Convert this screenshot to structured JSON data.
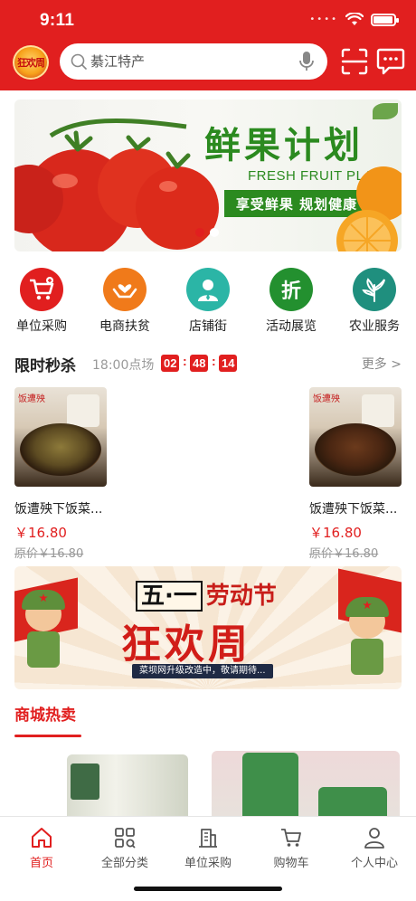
{
  "status_bar": {
    "time": "9:11",
    "battery_level": 0.95
  },
  "header": {
    "logo_text": "狂欢周",
    "search_placeholder": "綦江特产",
    "icons": [
      "search-icon",
      "microphone-icon",
      "scan-icon",
      "message-icon"
    ]
  },
  "banner": {
    "title": "鲜果计划",
    "subtitle": "FRESH FRUIT PLAN",
    "slogan": "享受鲜果  规划健康",
    "page_count": 2,
    "active_page": 1
  },
  "categories": [
    {
      "label": "单位采购",
      "icon": "cart-icon",
      "color": "#e11f1f"
    },
    {
      "label": "电商扶贫",
      "icon": "hands-heart-icon",
      "color": "#f07a1a"
    },
    {
      "label": "店铺街",
      "icon": "person-icon",
      "color": "#2bb5a6"
    },
    {
      "label": "活动展览",
      "icon": "discount-icon",
      "color": "#23902f"
    },
    {
      "label": "农业服务",
      "icon": "plant-icon",
      "color": "#1f8f7e"
    }
  ],
  "flash_sale": {
    "title": "限时秒杀",
    "session": "18:00点场",
    "countdown": [
      "02",
      "48",
      "14"
    ],
    "more": "更多 >",
    "products": [
      {
        "brand": "饭遭殃",
        "name": "饭遭殃下饭菜...",
        "price": "￥16.80",
        "original_price": "原价￥16.80"
      },
      {
        "brand": "饭遭殃",
        "name": "饭遭殃下饭菜...",
        "price": "￥16.80",
        "original_price": "原价￥16.80"
      }
    ]
  },
  "promo": {
    "title_box": "五·一",
    "title_rest": "劳动节",
    "headline": "狂欢周",
    "note": "菜坝网升级改造中，敬请期待..."
  },
  "hot_section": {
    "title": "商城热卖"
  },
  "tabbar": {
    "tabs": [
      {
        "label": "首页",
        "icon": "home-icon",
        "active": true
      },
      {
        "label": "全部分类",
        "icon": "grid-icon",
        "active": false
      },
      {
        "label": "单位采购",
        "icon": "building-icon",
        "active": false
      },
      {
        "label": "购物车",
        "icon": "cart-icon",
        "active": false
      },
      {
        "label": "个人中心",
        "icon": "user-icon",
        "active": false
      }
    ]
  },
  "colors": {
    "brand_red": "#e11f1f",
    "text": "#222222",
    "muted": "#999999"
  }
}
